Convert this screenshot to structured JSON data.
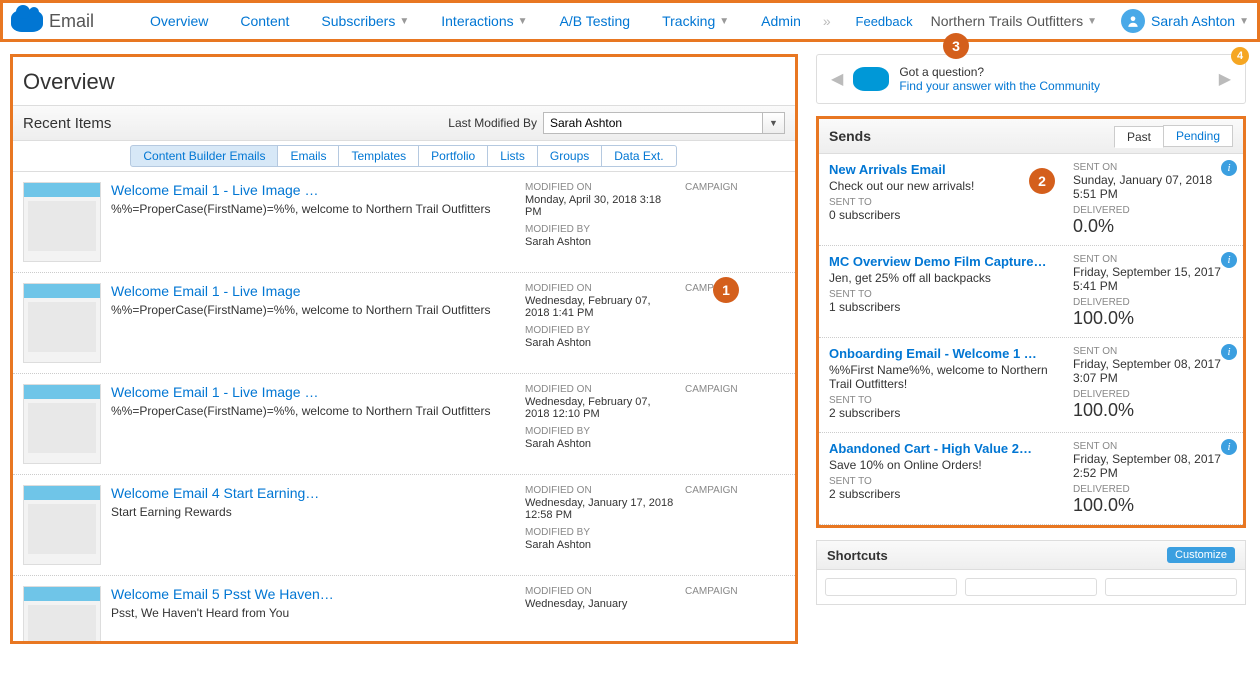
{
  "app_name": "Email",
  "nav": [
    "Overview",
    "Content",
    "Subscribers",
    "Interactions",
    "A/B Testing",
    "Tracking",
    "Admin"
  ],
  "nav_has_caret": [
    false,
    false,
    true,
    true,
    false,
    true,
    false
  ],
  "feedback": "Feedback",
  "business_unit": "Northern Trails Outfitters",
  "user_name": "Sarah Ashton",
  "overview_title": "Overview",
  "recent_items_label": "Recent Items",
  "last_modified_by_label": "Last Modified By",
  "last_modified_by_value": "Sarah Ashton",
  "mini_tabs": [
    "Content Builder Emails",
    "Emails",
    "Templates",
    "Portfolio",
    "Lists",
    "Groups",
    "Data Ext."
  ],
  "mini_tab_active": 0,
  "col_labels": {
    "modified_on": "MODIFIED ON",
    "modified_by": "MODIFIED BY",
    "campaign": "CAMPAIGN"
  },
  "items": [
    {
      "title": "Welcome Email 1 - Live Image …",
      "desc": "%%=ProperCase(FirstName)=%%, welcome to Northern Trail Outfitters",
      "modified_on": "Monday, April 30, 2018 3:18 PM",
      "modified_by": "Sarah Ashton"
    },
    {
      "title": "Welcome Email 1 - Live Image",
      "desc": "%%=ProperCase(FirstName)=%%, welcome to Northern Trail Outfitters",
      "modified_on": "Wednesday, February 07, 2018 1:41 PM",
      "modified_by": "Sarah Ashton"
    },
    {
      "title": "Welcome Email 1 - Live Image …",
      "desc": "%%=ProperCase(FirstName)=%%, welcome to Northern Trail Outfitters",
      "modified_on": "Wednesday, February 07, 2018 12:10 PM",
      "modified_by": "Sarah Ashton"
    },
    {
      "title": "Welcome Email 4 Start Earning…",
      "desc": "Start Earning Rewards",
      "modified_on": "Wednesday, January 17, 2018 12:58 PM",
      "modified_by": "Sarah Ashton"
    },
    {
      "title": "Welcome Email 5 Psst We Haven…",
      "desc": "Psst, We Haven't Heard from You",
      "modified_on": "Wednesday, January",
      "modified_by": ""
    }
  ],
  "question": {
    "title": "Got a question?",
    "link": "Find your answer with the Community"
  },
  "sends_label": "Sends",
  "sends_tabs": [
    "Past",
    "Pending"
  ],
  "sends_tab_active": 0,
  "send_labels": {
    "sent_on": "SENT ON",
    "sent_to": "SENT TO",
    "delivered": "DELIVERED"
  },
  "sends": [
    {
      "title": "New Arrivals Email",
      "desc": "Check out our new arrivals!",
      "sent_to": "0 subscribers",
      "sent_on": "Sunday, January 07, 2018 5:51 PM",
      "delivered": "0.0%"
    },
    {
      "title": "MC Overview Demo Film Capture…",
      "desc": "Jen, get 25% off all backpacks",
      "sent_to": "1 subscribers",
      "sent_on": "Friday, September 15, 2017 5:41 PM",
      "delivered": "100.0%"
    },
    {
      "title": "Onboarding Email - Welcome 1 …",
      "desc": "%%First Name%%, welcome to Northern Trail Outfitters!",
      "sent_to": "2 subscribers",
      "sent_on": "Friday, September 08, 2017 3:07 PM",
      "delivered": "100.0%"
    },
    {
      "title": "Abandoned Cart - High Value 2…",
      "desc": "Save 10% on Online Orders!",
      "sent_to": "2 subscribers",
      "sent_on": "Friday, September 08, 2017 2:52 PM",
      "delivered": "100.0%"
    }
  ],
  "shortcuts_label": "Shortcuts",
  "customize_label": "Customize",
  "callouts": {
    "1": "1",
    "2": "2",
    "3": "3",
    "4": "4"
  }
}
